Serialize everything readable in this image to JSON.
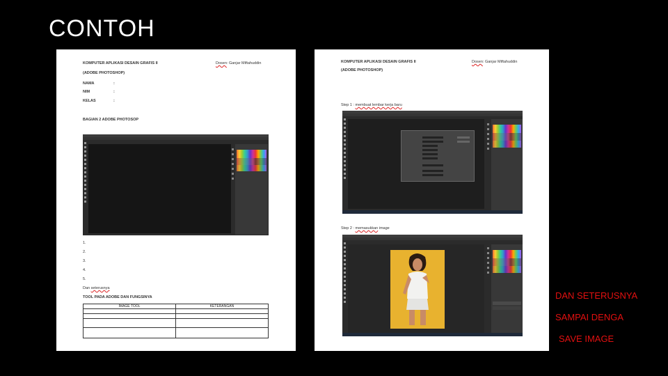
{
  "title": "CONTOH",
  "page1": {
    "header_left": "KOMPUTER APLIKASI DESAIN GRAFIS II",
    "header_right_label": "Dosen",
    "header_right_name": ": Ganjar Miftahuddin",
    "subheader": "(ADOBE PHOTOSHOP)",
    "fields": [
      {
        "label": "NAMA",
        "sep": ":"
      },
      {
        "label": "NIM",
        "sep": ":"
      },
      {
        "label": "KELAS",
        "sep": ":"
      }
    ],
    "section_title": "BAGIAN 2 ADOBE PHOTOSOP",
    "numbered": [
      "1.",
      "2.",
      "3.",
      "4.",
      "5."
    ],
    "dan_prefix": "Dan",
    "dan_word": "seterusnya",
    "table_title": "TOOL PADA ADOBE DAN FUNGSINYA",
    "table_headers": [
      "IMAGE TOOL",
      "KETERANGAN"
    ]
  },
  "page2": {
    "header_left": "KOMPUTER APLIKASI DESAIN GRAFIS II",
    "header_right_label": "Dosen",
    "header_right_name": ": Ganjar Miftahuddin",
    "subheader": "(ADOBE PHOTOSHOP)",
    "step1_prefix": "Step 1 :",
    "step1_text": "membuat lembar kerja baru",
    "step2_prefix": "Step 2 :",
    "step2_text": "memasukkan",
    "step2_suffix": "image"
  },
  "side_notes": [
    "DAN SETERUSNYA",
    "SAMPAI DENGA",
    "SAVE IMAGE"
  ]
}
